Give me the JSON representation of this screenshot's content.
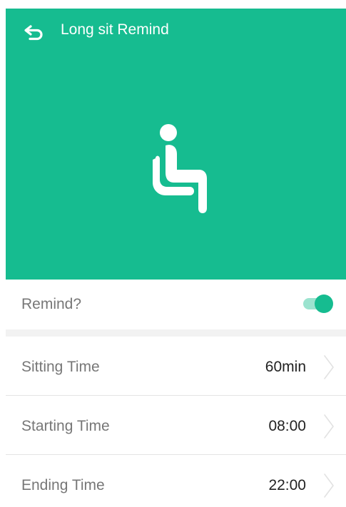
{
  "header": {
    "title": "Long sit Remind",
    "back_icon": "back-arrow-icon",
    "background_color": "#16bc90"
  },
  "hero": {
    "icon": "sitting-person-icon"
  },
  "remind": {
    "label": "Remind?",
    "enabled": true,
    "accent_color": "#16bc90"
  },
  "settings": [
    {
      "label": "Sitting Time",
      "value": "60min"
    },
    {
      "label": "Starting Time",
      "value": "08:00"
    },
    {
      "label": "Ending Time",
      "value": "22:00"
    }
  ]
}
